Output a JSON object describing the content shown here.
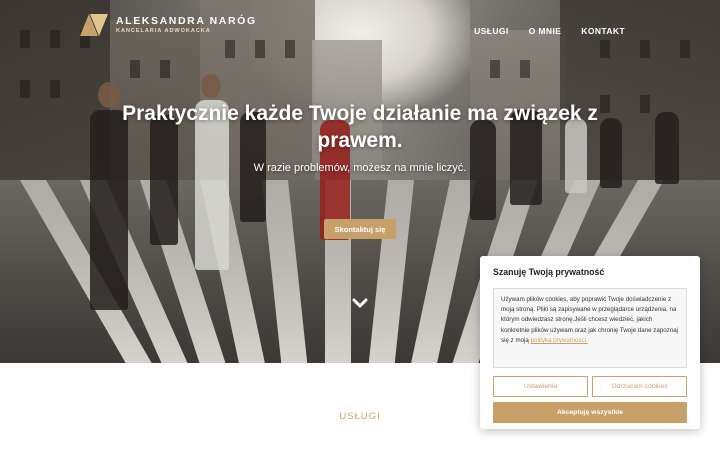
{
  "brand": {
    "name": "ALEKSANDRA NARÓG",
    "subtitle": "KANCELARIA ADWOKACKA",
    "accent_color": "#c8a16a",
    "logo_icon": "logo-monogram-icon"
  },
  "nav": {
    "items": [
      {
        "label": "USŁUGI"
      },
      {
        "label": "O MNIE"
      },
      {
        "label": "KONTAKT"
      }
    ]
  },
  "hero": {
    "title": "Praktycznie każde Twoje działanie ma związek z prawem.",
    "subtitle": "W razie problemów, możesz na mnie liczyć.",
    "cta_label": "Skontaktuj się",
    "scroll_icon": "chevron-down-icon"
  },
  "services": {
    "heading": "USŁUGI"
  },
  "cookie_banner": {
    "title": "Szanuję Twoją prywatność",
    "text": "Używam plików cookies, aby poprawić Twoje doświadczenie z moją stroną. Pliki są zapisywane w przeglądarce urządzenia, na którym odwiedzasz stronę.Jeśli chcesz wiedzieć, jakich konkretnie plików używam oraz jak chronię Twoje dane zapoznaj się z moją ",
    "link_label": "polityką prywatności.",
    "settings_label": "Ustawienia",
    "reject_label": "Odrzucam cookies",
    "accept_label": "Akceptuję wszystkie"
  }
}
